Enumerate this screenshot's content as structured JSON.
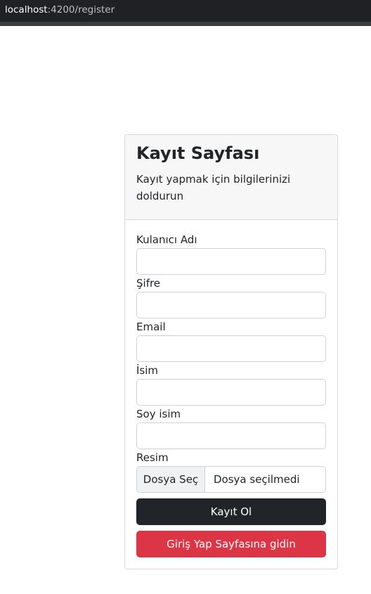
{
  "browser": {
    "url_host": "localhost",
    "url_rest": ":4200/register"
  },
  "card": {
    "title": "Kayıt Sayfası",
    "subtitle": "Kayıt yapmak için bilgilerinizi doldurun"
  },
  "form": {
    "username_label": "Kulanıcı Adı",
    "username_value": "",
    "password_label": "Şifre",
    "password_value": "",
    "email_label": "Email",
    "email_value": "",
    "name_label": "İsim",
    "name_value": "",
    "surname_label": "Soy isim",
    "surname_value": "",
    "image_label": "Resim",
    "file_button_label": "Dosya Seç",
    "file_status": "Dosya seçilmedi"
  },
  "actions": {
    "register_label": "Kayıt Ol",
    "go_login_label": "Giriş Yap Sayfasına gidin"
  },
  "colors": {
    "register_button": "#212529",
    "login_button": "#dc3545",
    "header_bg": "#f7f7f7"
  }
}
